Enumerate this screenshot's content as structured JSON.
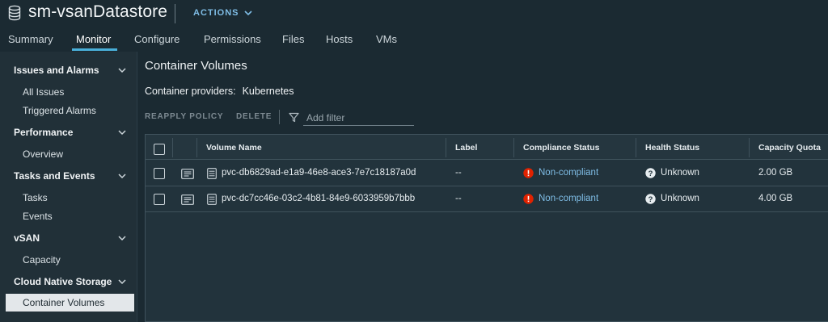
{
  "header": {
    "title": "sm-vsanDatastore",
    "actions_label": "ACTIONS",
    "icon": "database-icon"
  },
  "tabs": [
    {
      "label": "Summary"
    },
    {
      "label": "Monitor",
      "active": true
    },
    {
      "label": "Configure"
    },
    {
      "label": "Permissions"
    },
    {
      "label": "Files"
    },
    {
      "label": "Hosts"
    },
    {
      "label": "VMs"
    }
  ],
  "sidebar": {
    "sections": [
      {
        "label": "Issues and Alarms",
        "items": [
          "All Issues",
          "Triggered Alarms"
        ]
      },
      {
        "label": "Performance",
        "items": [
          "Overview"
        ]
      },
      {
        "label": "Tasks and Events",
        "items": [
          "Tasks",
          "Events"
        ]
      },
      {
        "label": "vSAN",
        "items": [
          "Capacity"
        ]
      },
      {
        "label": "Cloud Native Storage",
        "items": [
          "Container Volumes"
        ]
      }
    ],
    "selected_item": "Container Volumes"
  },
  "main": {
    "title": "Container Volumes",
    "providers_label": "Container providers:",
    "providers_value": "Kubernetes",
    "toolbar": {
      "reapply_label": "REAPPLY POLICY",
      "delete_label": "DELETE",
      "filter_placeholder": "Add filter"
    },
    "table": {
      "columns": [
        "Volume Name",
        "Label",
        "Compliance Status",
        "Health Status",
        "Capacity Quota"
      ],
      "rows": [
        {
          "volume_name": "pvc-db6829ad-e1a9-46e8-ace3-7e7c18187a0d",
          "label": "--",
          "compliance": "Non-compliant",
          "health": "Unknown",
          "capacity": "2.00 GB"
        },
        {
          "volume_name": "pvc-dc7cc46e-03c2-4b81-84e9-6033959b7bbb",
          "label": "--",
          "compliance": "Non-compliant",
          "health": "Unknown",
          "capacity": "4.00 GB"
        }
      ]
    }
  },
  "colors": {
    "accent": "#49afd9",
    "link": "#7fbde6",
    "error": "#e12200",
    "background": "#1b2a32"
  }
}
